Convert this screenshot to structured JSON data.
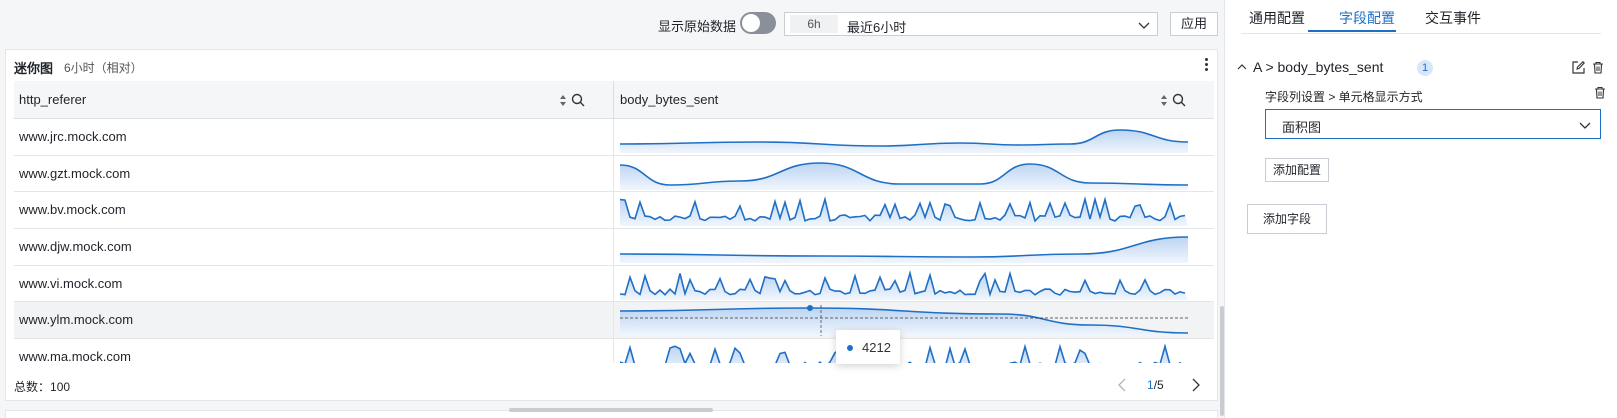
{
  "toolbar": {
    "raw_label": "显示原始数据",
    "time_badge": "6h",
    "time_text": "最近6小时",
    "apply_label": "应用"
  },
  "card": {
    "title": "迷你图",
    "subtitle": "6小时（相对）",
    "columns": [
      "http_referer",
      "body_bytes_sent"
    ],
    "rows": [
      {
        "referer": "www.jrc.mock.com"
      },
      {
        "referer": "www.gzt.mock.com"
      },
      {
        "referer": "www.bv.mock.com"
      },
      {
        "referer": "www.djw.mock.com"
      },
      {
        "referer": "www.vi.mock.com"
      },
      {
        "referer": "www.ylm.mock.com"
      },
      {
        "referer": "www.ma.mock.com"
      }
    ],
    "tooltip_value": "4212",
    "total_label": "总数：",
    "total_value": "100",
    "page_current": "1",
    "page_total": "/5"
  },
  "panel": {
    "tabs": [
      "通用配置",
      "字段配置",
      "交互事件"
    ],
    "active_tab": "字段配置",
    "field_name": "A > body_bytes_sent",
    "field_count": "1",
    "setting_path": "字段列设置 > 单元格显示方式",
    "display_mode": "面积图",
    "add_config_label": "添加配置",
    "add_field_label": "添加字段"
  },
  "colors": {
    "accent": "#1f6fc5",
    "sparkline_fill": "#d8e6f7"
  }
}
